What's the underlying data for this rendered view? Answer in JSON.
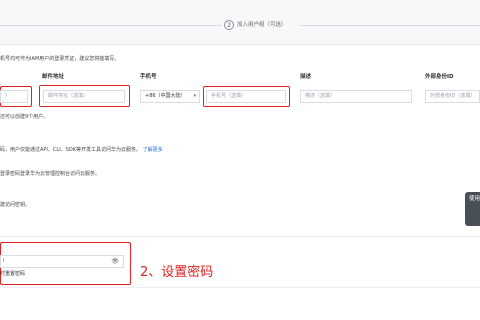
{
  "step": {
    "number": "2",
    "label": "加入用户组（可选）"
  },
  "intro_text": "机号均可作为IAM用户的登录凭证，建议您将能填写。",
  "columns": {
    "email": "邮件地址",
    "phone": "手机号",
    "desc": "描述",
    "external_id": "外部身份ID"
  },
  "fields": {
    "name_tail": "）",
    "email_placeholder": "邮件地址（选填）",
    "country_code": "+86（中国大陆）",
    "phone_placeholder": "手机号（选填）",
    "desc_placeholder": "描述（选填）",
    "external_placeholder": "外部身份ID（选填）"
  },
  "caret": "▾",
  "limit_note": "还可以创建9个用户。",
  "programmatic": {
    "text": "码，用户仅能通过API、CLI、SDK等开发工具访问华为云服务。",
    "link": "了解更多"
  },
  "console_note": "登录密码登录华为云管理控制台访问云服务。",
  "access_key_note": "建访问密钥。",
  "side_tab": "使用",
  "password": {
    "value": "I",
    "eye_icon": "👁",
    "reset_label": "时重置密码"
  },
  "annotation": "2、设置密码",
  "colors": {
    "annotation_red": "#e02020",
    "link_blue": "#1a6fe8"
  }
}
